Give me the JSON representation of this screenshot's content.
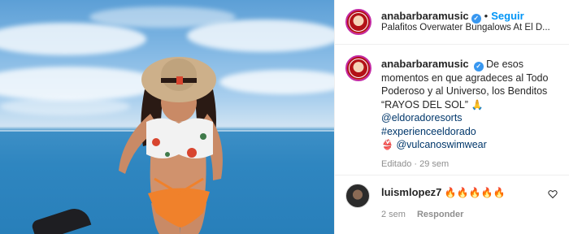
{
  "post": {
    "username": "anabarbaramusic",
    "verified_mark": "✓",
    "dot": "•",
    "follow_label": "Seguir",
    "location": "Palafitos Overwater Bungalows At El D...",
    "more_icon": "more-horizontal-icon"
  },
  "caption": {
    "username": "anabarbaramusic",
    "verified_mark": "✓",
    "text": "De esos momentos en que agradeces al Todo Poderoso y al Universo, los Benditos “RAYOS DEL SOL”",
    "text_emoji": "🙏",
    "tags": [
      "@eldoradoresorts",
      "#experienceeldorado"
    ],
    "last_line_emoji": "👙",
    "last_tag": "@vulcanoswimwear",
    "meta": "Editado · 29 sem"
  },
  "comment": {
    "username": "luismlopez7",
    "text": "🔥🔥🔥🔥🔥",
    "age": "2 sem",
    "reply_label": "Responder"
  },
  "colors": {
    "link": "#00376b",
    "follow": "#0095f6",
    "muted": "#8e8e8e",
    "verified": "#3897f0"
  }
}
